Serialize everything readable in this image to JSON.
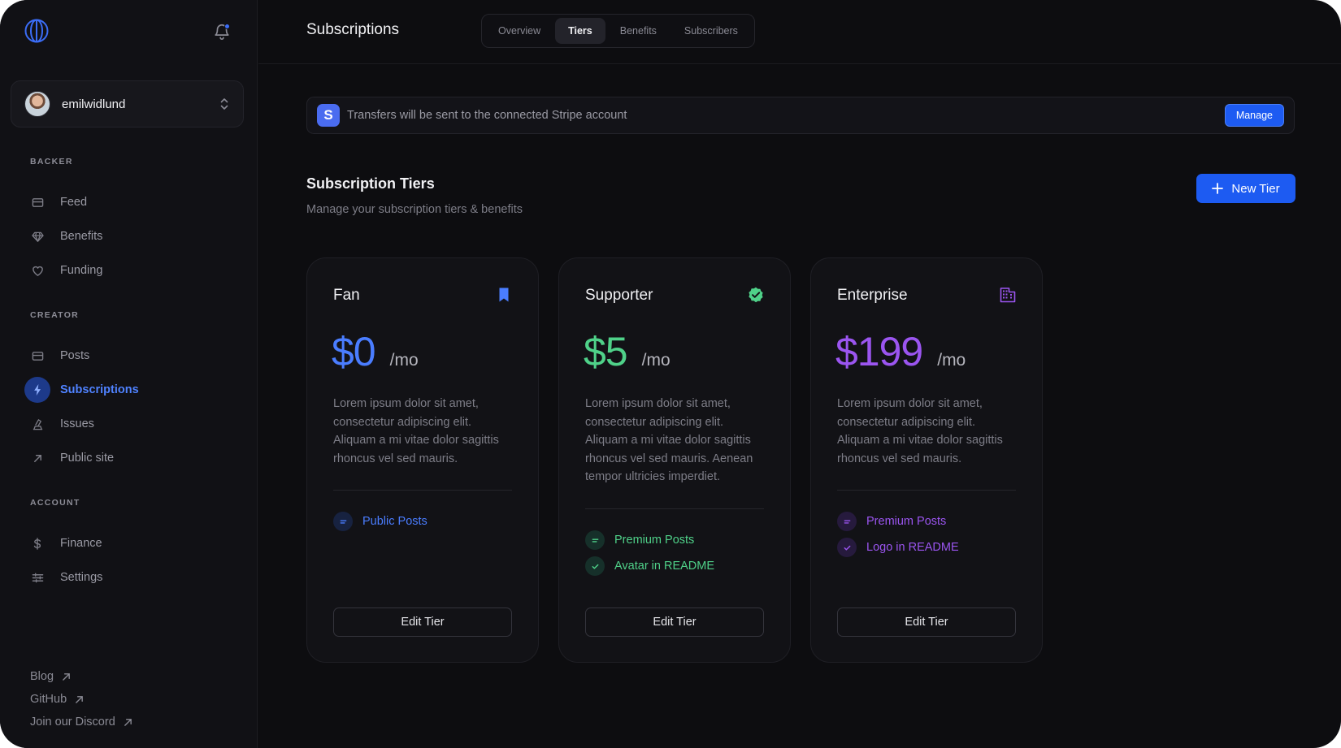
{
  "sidebar": {
    "account_name": "emilwidlund",
    "sections": [
      {
        "label": "BACKER",
        "items": [
          {
            "label": "Feed",
            "icon": "feed-icon"
          },
          {
            "label": "Benefits",
            "icon": "diamond-icon"
          },
          {
            "label": "Funding",
            "icon": "heart-icon"
          }
        ]
      },
      {
        "label": "CREATOR",
        "items": [
          {
            "label": "Posts",
            "icon": "posts-icon"
          },
          {
            "label": "Subscriptions",
            "icon": "bolt-icon",
            "active": true
          },
          {
            "label": "Issues",
            "icon": "issues-icon"
          },
          {
            "label": "Public site",
            "icon": "arrow-up-right-icon"
          }
        ]
      },
      {
        "label": "ACCOUNT",
        "items": [
          {
            "label": "Finance",
            "icon": "dollar-icon"
          },
          {
            "label": "Settings",
            "icon": "sliders-icon"
          }
        ]
      }
    ],
    "footer_links": [
      "Blog",
      "GitHub",
      "Join our Discord"
    ]
  },
  "header": {
    "title": "Subscriptions",
    "tabs": [
      {
        "label": "Overview"
      },
      {
        "label": "Tiers",
        "active": true
      },
      {
        "label": "Benefits"
      },
      {
        "label": "Subscribers"
      }
    ]
  },
  "banner": {
    "badge": "S",
    "text": "Transfers will be sent to the connected Stripe account",
    "button": "Manage"
  },
  "tiers_section": {
    "title": "Subscription Tiers",
    "subtitle": "Manage your subscription tiers & benefits",
    "new_button": "New Tier"
  },
  "tiers": [
    {
      "name": "Fan",
      "icon": "bookmark-icon",
      "price": "$0",
      "unit": "/mo",
      "accent": "#4a7dff",
      "description": "Lorem ipsum dolor sit amet, consectetur adipiscing elit. Aliquam a mi vitae dolor sagittis rhoncus vel sed mauris.",
      "benefits": [
        {
          "label": "Public Posts",
          "icon": "lines-icon"
        }
      ],
      "button": "Edit Tier"
    },
    {
      "name": "Supporter",
      "icon": "verified-badge-icon",
      "price": "$5",
      "unit": "/mo",
      "accent": "#4fd189",
      "description": "Lorem ipsum dolor sit amet, consectetur adipiscing elit. Aliquam a mi vitae dolor sagittis rhoncus vel sed mauris. Aenean tempor ultricies imperdiet.",
      "benefits": [
        {
          "label": "Premium Posts",
          "icon": "lines-icon"
        },
        {
          "label": "Avatar in README",
          "icon": "check-icon"
        }
      ],
      "button": "Edit Tier"
    },
    {
      "name": "Enterprise",
      "icon": "building-icon",
      "price": "$199",
      "unit": "/mo",
      "accent": "#9b55f0",
      "description": "Lorem ipsum dolor sit amet, consectetur adipiscing elit. Aliquam a mi vitae dolor sagittis rhoncus vel sed mauris.",
      "benefits": [
        {
          "label": "Premium Posts",
          "icon": "lines-icon"
        },
        {
          "label": "Logo in README",
          "icon": "check-icon"
        }
      ],
      "button": "Edit Tier"
    }
  ]
}
